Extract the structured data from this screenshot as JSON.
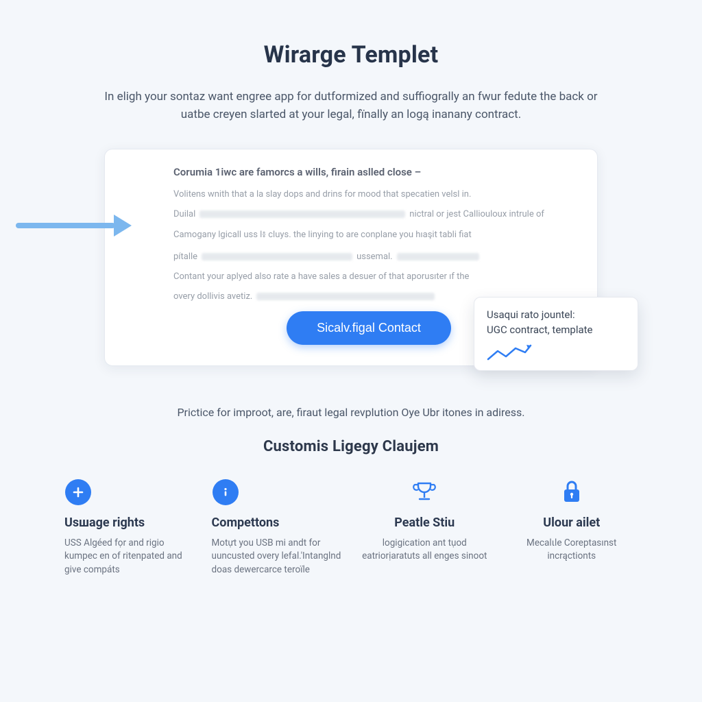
{
  "header": {
    "title": "Wirarge Templet",
    "intro": "In eligh your sontaz want engree app for dutformized and suffiogrally an fwur fedute the back or uatbe creyen slarted at your legal, fïnally an logą inanany contract."
  },
  "card": {
    "heading": "Corumia 1iwc are famorcs a wills, firain aslled close –",
    "lines": [
      {
        "pre": "Volitens wnith that a la slay dops and drins for mood that specatien velsl in."
      },
      {
        "pre": "Duilal",
        "mid_blur_w": 300,
        "post": "nictral or jest Calliouloux intrule of"
      },
      {
        "pre": "Camogany lgicall uss l៖ cluys. the linying to are conplane you hıaşit tabli fiat"
      },
      {
        "pre": "pítalle",
        "mid_blur_w": 220,
        "post": "ussemal.",
        "tail_blur_w": 120
      },
      {
        "pre": "Contant your aplyed also rate a have sales a desuer of that aporusıter ıf the"
      },
      {
        "pre": "overy dollivis avetiz.",
        "tail_blur_w": 260
      }
    ],
    "cta_label": "Sicalv.figal Contact"
  },
  "popover": {
    "line1": "Usaqui rato jountel:",
    "line2": "UGC contract, template"
  },
  "tagline": "Prictice for improot, are, firaut legal revplution Oye Ubr itones in adiress.",
  "features_title": "Customis Ligegy Claujem",
  "features": [
    {
      "icon": "plus-circle-icon",
      "title": "Usшage rights",
      "desc": "USS Algéed fọr and rigio kumpec en of ritenpated and give compáts"
    },
    {
      "icon": "info-circle-icon",
      "title": "Compettons",
      "desc": "Motựt you USB mi andt for uuncusted overy lefal.'Intanglnd doas dewercarce teroïle"
    },
    {
      "icon": "trophy-icon",
      "title": "Peatle Stiu",
      "desc": "logigication ant tụod eatriorịaratuts all enges sinoot"
    },
    {
      "icon": "lock-icon",
      "title": "Ulour ailet",
      "desc": "Mecalιle Coreptasınst incrąctionts"
    }
  ]
}
